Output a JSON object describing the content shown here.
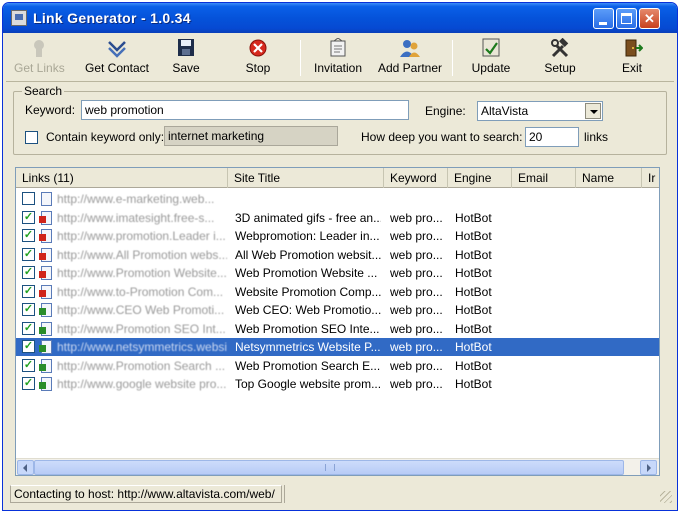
{
  "window": {
    "title": "Link Generator - 1.0.34"
  },
  "toolbar": {
    "buttons": [
      {
        "label": "Get Links",
        "icon": "get-links-icon",
        "enabled": false
      },
      {
        "label": "Get Contact",
        "icon": "get-contact-icon",
        "enabled": true
      },
      {
        "label": "Save",
        "icon": "save-icon",
        "enabled": true
      },
      {
        "label": "Stop",
        "icon": "stop-icon",
        "enabled": true
      },
      {
        "label": "Invitation",
        "icon": "invitation-icon",
        "enabled": true
      },
      {
        "label": "Add Partner",
        "icon": "add-partner-icon",
        "enabled": true
      },
      {
        "label": "Update",
        "icon": "update-icon",
        "enabled": true
      },
      {
        "label": "Setup",
        "icon": "setup-icon",
        "enabled": true
      },
      {
        "label": "Exit",
        "icon": "exit-icon",
        "enabled": true
      }
    ]
  },
  "search": {
    "group_label": "Search",
    "keyword_label": "Keyword:",
    "keyword_value": "web promotion",
    "engine_label": "Engine:",
    "engine_value": "AltaVista",
    "contain_label": "Contain keyword only:",
    "contain_checked": false,
    "contain_value": "internet marketing",
    "depth_label": "How deep you want to search:",
    "depth_value": "20",
    "depth_unit": "links"
  },
  "list": {
    "columns": [
      "Links (11)",
      "Site Title",
      "Keyword",
      "Engine",
      "Email",
      "Name",
      "Ir"
    ],
    "rows": [
      {
        "link": "http://www.e-marketing.web...",
        "title": "",
        "keyword": "",
        "engine": "",
        "checked": false,
        "flag": "none",
        "selected": false
      },
      {
        "link": "http://www.imatesight.free-s...",
        "title": "3D animated gifs - free an...",
        "keyword": "web pro...",
        "engine": "HotBot",
        "checked": true,
        "flag": "red",
        "selected": false
      },
      {
        "link": "http://www.promotion.Leader i...",
        "title": "Webpromotion: Leader in...",
        "keyword": "web pro...",
        "engine": "HotBot",
        "checked": true,
        "flag": "red",
        "selected": false
      },
      {
        "link": "http://www.All Promotion webs...",
        "title": "All Web Promotion websit...",
        "keyword": "web pro...",
        "engine": "HotBot",
        "checked": true,
        "flag": "red",
        "selected": false
      },
      {
        "link": "http://www.Promotion Website...",
        "title": "Web Promotion Website ...",
        "keyword": "web pro...",
        "engine": "HotBot",
        "checked": true,
        "flag": "red",
        "selected": false
      },
      {
        "link": "http://www.to-Promotion Com...",
        "title": "Website Promotion Comp...",
        "keyword": "web pro...",
        "engine": "HotBot",
        "checked": true,
        "flag": "red",
        "selected": false
      },
      {
        "link": "http://www.CEO Web Promoti...",
        "title": "Web CEO: Web Promotio...",
        "keyword": "web pro...",
        "engine": "HotBot",
        "checked": true,
        "flag": "green",
        "selected": false
      },
      {
        "link": "http://www.Promotion SEO Int...",
        "title": "Web Promotion SEO Inte...",
        "keyword": "web pro...",
        "engine": "HotBot",
        "checked": true,
        "flag": "green",
        "selected": false
      },
      {
        "link": "http://www.netsymmetrics.website...",
        "title": "Netsymmetrics Website P...",
        "keyword": "web pro...",
        "engine": "HotBot",
        "checked": true,
        "flag": "green",
        "selected": true
      },
      {
        "link": "http://www.Promotion Search ...",
        "title": "Web Promotion Search E...",
        "keyword": "web pro...",
        "engine": "HotBot",
        "checked": true,
        "flag": "green",
        "selected": false
      },
      {
        "link": "http://www.google website pro...",
        "title": "Top Google website prom...",
        "keyword": "web pro...",
        "engine": "HotBot",
        "checked": true,
        "flag": "green",
        "selected": false
      }
    ]
  },
  "status": {
    "text": "Contacting to host: http://www.altavista.com/web/"
  },
  "colors": {
    "titlebar": "#0553da",
    "selection": "#316ac5",
    "window": "#ece9d8"
  }
}
